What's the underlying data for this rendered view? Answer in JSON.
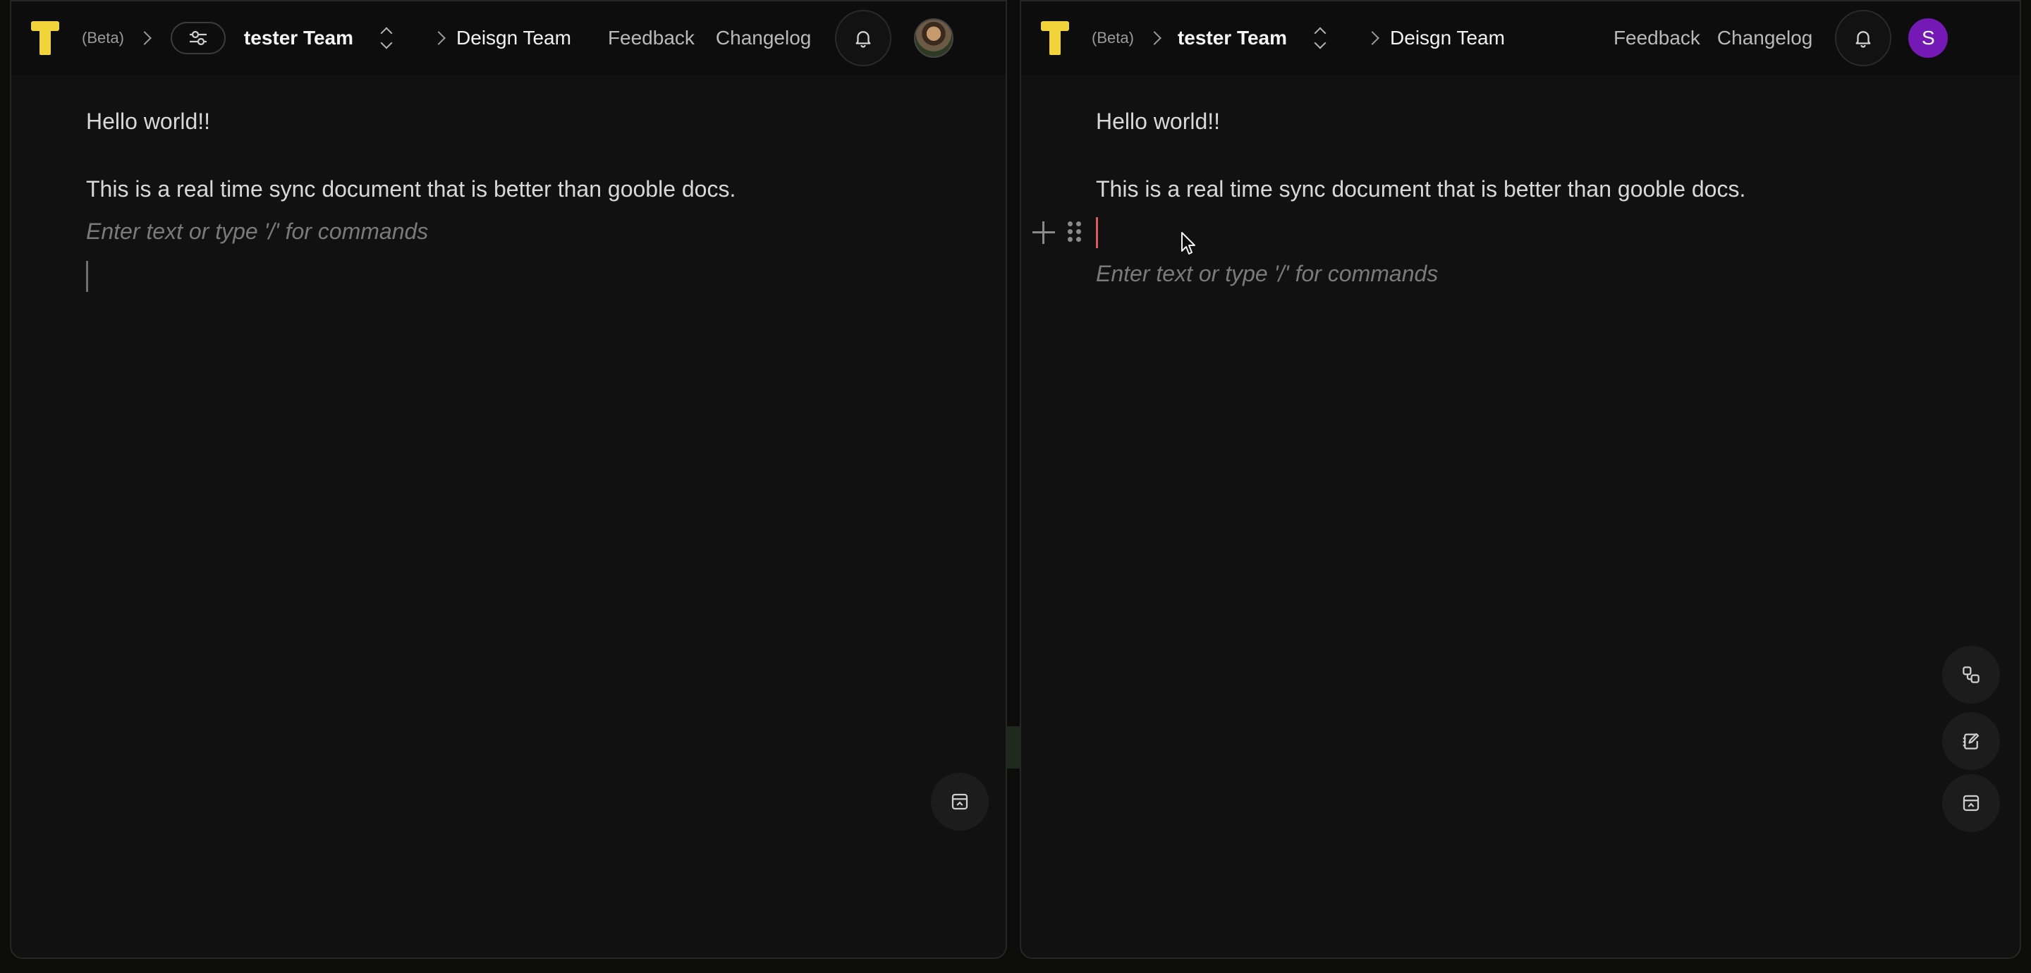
{
  "left_pane": {
    "beta": "(Beta)",
    "team": "tester Team",
    "sub_team": "Deisgn Team",
    "nav": {
      "feedback": "Feedback",
      "changelog": "Changelog"
    },
    "doc": {
      "line1": "Hello world!!",
      "line2": "This is a real time sync document that is better than gooble docs.",
      "placeholder": "Enter text or type '/' for commands"
    }
  },
  "right_pane": {
    "beta": "(Beta)",
    "team": "tester Team",
    "sub_team": "Deisgn Team",
    "nav": {
      "feedback": "Feedback",
      "changelog": "Changelog"
    },
    "avatar_letter": "S",
    "doc": {
      "line1": "Hello world!!",
      "line2": "This is a real time sync document that is better than gooble docs.",
      "placeholder": "Enter text or type '/' for commands"
    }
  },
  "colors": {
    "logo": "#f0d43a",
    "avatar_purple": "#7419b6",
    "caret_red": "#e05a5a",
    "caret_gray": "#6f6f6f"
  },
  "icons": [
    "t-logo-icon",
    "chevron-right-icon",
    "sliders-icon",
    "chevron-up-down-icon",
    "bell-icon",
    "plus-icon",
    "drag-handle-icon",
    "layout-panel-icon",
    "shapes-icon",
    "edit-note-icon",
    "mouse-cursor-icon"
  ]
}
